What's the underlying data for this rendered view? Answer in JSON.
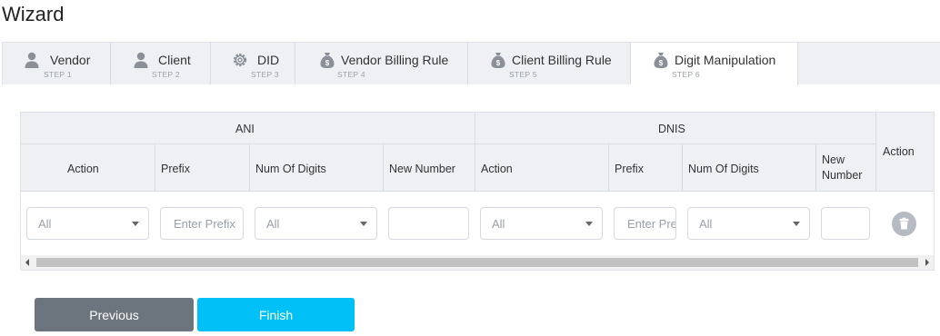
{
  "page": {
    "title": "Wizard"
  },
  "tabs": [
    {
      "label": "Vendor",
      "step": "STEP 1",
      "icon": "user-icon"
    },
    {
      "label": "Client",
      "step": "STEP 2",
      "icon": "user-icon"
    },
    {
      "label": "DID",
      "step": "STEP 3",
      "icon": "gear-icon"
    },
    {
      "label": "Vendor Billing Rule",
      "step": "STEP 4",
      "icon": "money-bag-icon"
    },
    {
      "label": "Client Billing Rule",
      "step": "STEP 5",
      "icon": "money-bag-icon"
    },
    {
      "label": "Digit Manipulation",
      "step": "STEP 6",
      "icon": "money-bag-icon",
      "active": true
    }
  ],
  "table": {
    "groups": {
      "ani": "ANI",
      "dnis": "DNIS",
      "action": "Action"
    },
    "ani_columns": {
      "action": "Action",
      "prefix": "Prefix",
      "num_digits": "Num Of Digits",
      "new_number": "New Number"
    },
    "dnis_columns": {
      "action": "Action",
      "prefix": "Prefix",
      "num_digits": "Num Of Digits",
      "new_number_line1": "New",
      "new_number_line2": "Number"
    },
    "row": {
      "ani_action": "All",
      "ani_prefix_placeholder": "Enter Prefix",
      "ani_num_digits": "All",
      "ani_new_number": "",
      "dnis_action": "All",
      "dnis_prefix_placeholder": "Enter Prefix",
      "dnis_num_digits": "All",
      "dnis_new_number": ""
    }
  },
  "buttons": {
    "previous": "Previous",
    "finish": "Finish"
  },
  "colors": {
    "finish": "#00c1f7",
    "previous": "#6c757d",
    "tab_bg": "#eef0f4",
    "icon": "#8a8f98"
  }
}
